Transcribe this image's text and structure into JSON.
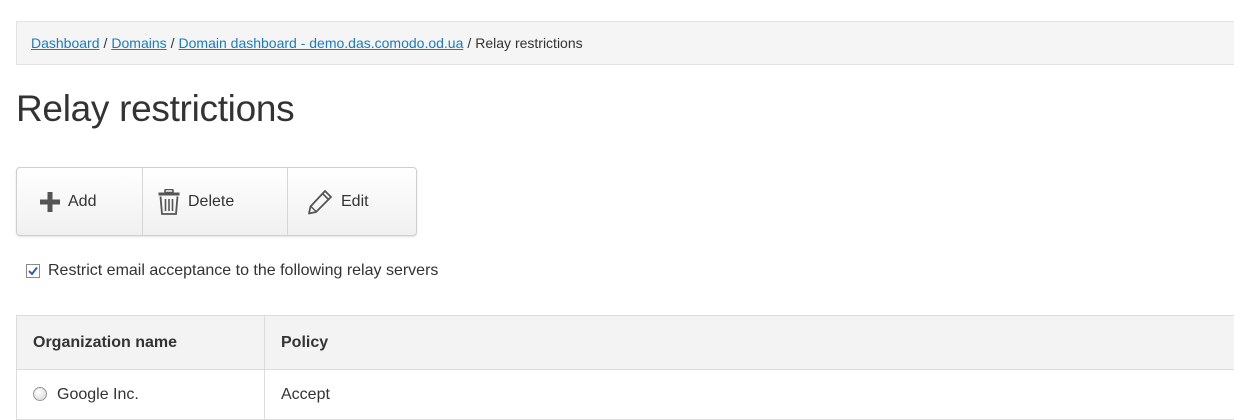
{
  "breadcrumb": {
    "items": [
      "Dashboard",
      "Domains",
      "Domain dashboard - demo.das.comodo.od.ua"
    ],
    "separator": "/",
    "current": "Relay restrictions"
  },
  "page_title": "Relay restrictions",
  "toolbar": {
    "add_label": "Add",
    "delete_label": "Delete",
    "edit_label": "Edit",
    "add_icon": "plus-icon",
    "delete_icon": "trash-icon",
    "edit_icon": "pencil-icon"
  },
  "restrict": {
    "checked": true,
    "label": "Restrict email acceptance to the following relay servers"
  },
  "table": {
    "headers": [
      "Organization name",
      "Policy"
    ],
    "rows": [
      {
        "organization": "Google Inc.",
        "policy": "Accept",
        "selected": false
      }
    ]
  },
  "colors": {
    "link": "#1a7bc0",
    "add_icon": "#555555",
    "checkmark": "#2f5fb3"
  }
}
